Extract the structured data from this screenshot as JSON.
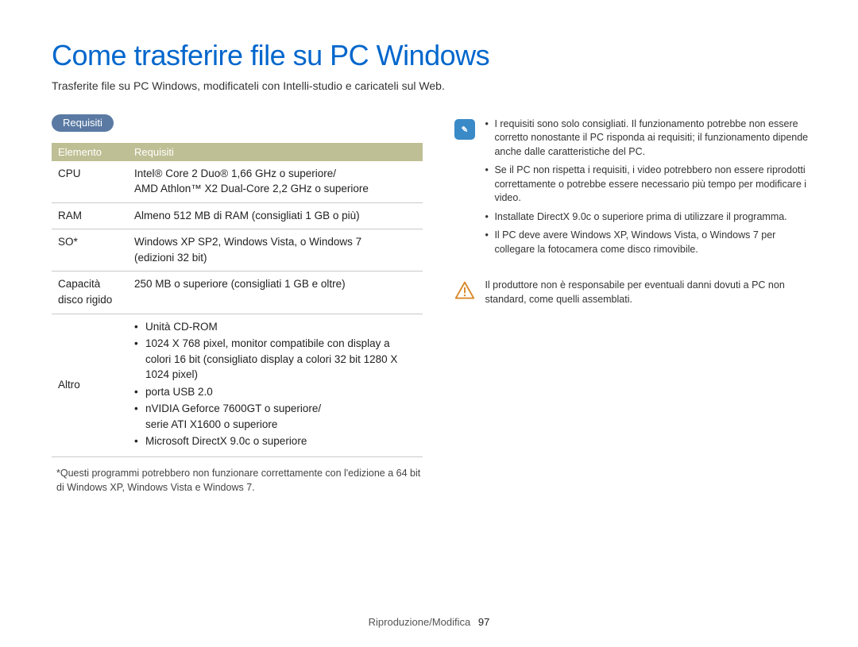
{
  "title": "Come trasferire file su PC Windows",
  "subtitle": "Trasferite file su PC Windows, modificateli con Intelli-studio e caricateli sul Web.",
  "section_label": "Requisiti",
  "table": {
    "headers": {
      "col1": "Elemento",
      "col2": "Requisiti"
    },
    "rows": {
      "cpu": {
        "label": "CPU",
        "value": "Intel® Core 2 Duo® 1,66 GHz o superiore/\nAMD Athlon™ X2 Dual-Core 2,2 GHz o superiore"
      },
      "ram": {
        "label": "RAM",
        "value": "Almeno 512 MB di RAM (consigliati 1 GB o più)"
      },
      "so": {
        "label": "SO*",
        "value": "Windows XP SP2, Windows Vista, o Windows 7\n(edizioni 32 bit)"
      },
      "hdd": {
        "label": "Capacità disco rigido",
        "value": "250 MB o superiore (consigliati 1 GB e oltre)"
      },
      "altro": {
        "label": "Altro",
        "items": [
          "Unità CD-ROM",
          "1024 X 768 pixel, monitor compatibile con display a colori 16 bit (consigliato display a colori 32 bit 1280 X 1024 pixel)",
          "porta USB 2.0",
          "nVIDIA Geforce 7600GT o superiore/\nserie ATI X1600 o superiore",
          "Microsoft DirectX 9.0c o superiore"
        ]
      }
    }
  },
  "footnote": "*Questi programmi potrebbero non funzionare correttamente con l'edizione a 64 bit di Windows XP, Windows Vista e Windows 7.",
  "info_notes": [
    "I requisiti sono solo consigliati. Il funzionamento potrebbe non essere corretto nonostante il PC risponda ai requisiti; il funzionamento dipende anche dalle caratteristiche del PC.",
    "Se il PC non rispetta i requisiti, i video potrebbero non essere riprodotti correttamente o potrebbe essere necessario più tempo per modificare i video.",
    "Installate DirectX 9.0c o superiore prima di utilizzare il programma.",
    "Il PC deve avere Windows XP, Windows Vista, o Windows 7 per collegare la fotocamera come disco rimovibile."
  ],
  "warn_note": "Il produttore non è responsabile per eventuali danni dovuti a PC non standard, come quelli assemblati.",
  "footer": {
    "section": "Riproduzione/Modifica",
    "page": "97"
  }
}
